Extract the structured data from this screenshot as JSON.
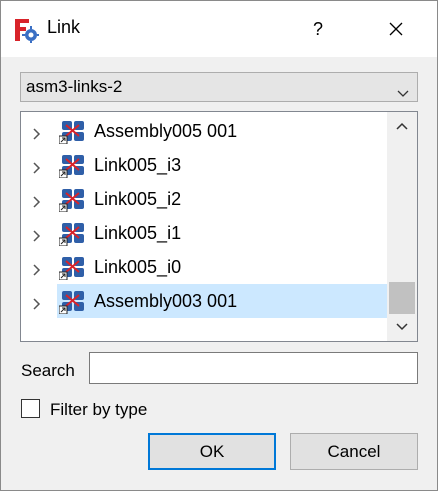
{
  "window": {
    "title": "Link",
    "help_label": "?",
    "app_icon": "freecad-gear-icon",
    "close_icon": "close-x-icon"
  },
  "document_select": {
    "value": "asm3-links-2"
  },
  "tree": {
    "items": [
      {
        "label": "Assembly005 001",
        "icon": "assembly-link-icon",
        "selected": false
      },
      {
        "label": "Link005_i3",
        "icon": "assembly-link-icon",
        "selected": false
      },
      {
        "label": "Link005_i2",
        "icon": "assembly-link-icon",
        "selected": false
      },
      {
        "label": "Link005_i1",
        "icon": "assembly-link-icon",
        "selected": false
      },
      {
        "label": "Link005_i0",
        "icon": "assembly-link-icon",
        "selected": false
      },
      {
        "label": "Assembly003 001",
        "icon": "assembly-link-icon",
        "selected": true
      }
    ]
  },
  "search": {
    "label": "Search",
    "value": ""
  },
  "filter": {
    "label": "Filter by type",
    "checked": false
  },
  "buttons": {
    "ok": "OK",
    "cancel": "Cancel"
  },
  "colors": {
    "selection": "#cce8ff",
    "accent": "#0078d7"
  }
}
